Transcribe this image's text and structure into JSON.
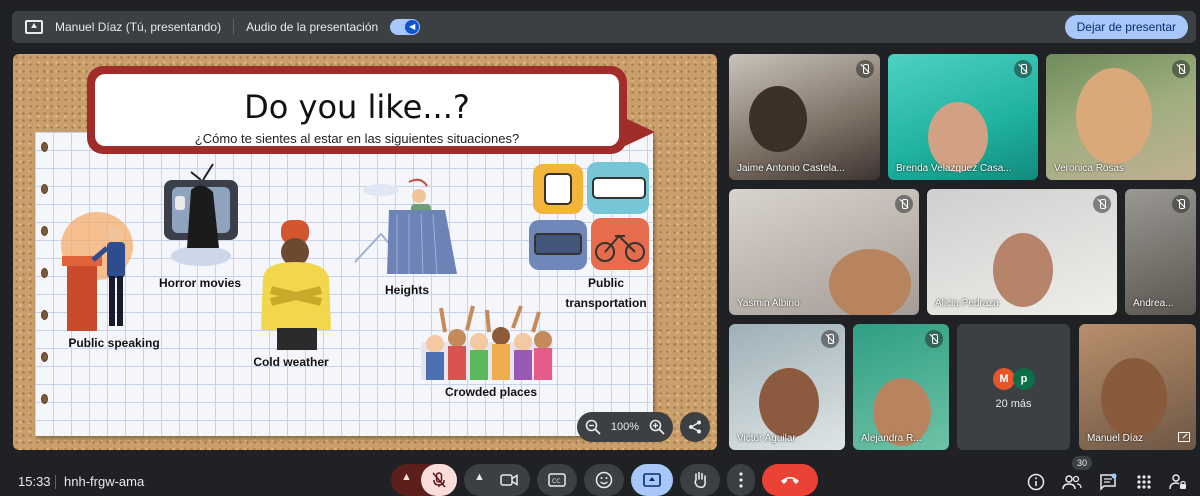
{
  "topbar": {
    "presenter": "Manuel Díaz (Tú, presentando)",
    "audio_label": "Audio de la presentación",
    "stop_button": "Dejar de presentar"
  },
  "slide": {
    "title": "Do you like...?",
    "subtitle": "¿Cómo te sientes al estar en las siguientes situaciones?",
    "labels": {
      "public_speaking": "Public speaking",
      "horror_movies": "Horror movies",
      "cold_weather": "Cold weather",
      "heights": "Heights",
      "public_transportation_1": "Public",
      "public_transportation_2": "transportation",
      "crowded_places": "Crowded places"
    },
    "zoom": "100%"
  },
  "participants": [
    {
      "name": "Jaime Antonio Castela..."
    },
    {
      "name": "Brenda Velazquez Casa..."
    },
    {
      "name": "Veronica Rosas"
    },
    {
      "name": "Yasmin Albino"
    },
    {
      "name": "Alicia Pedraza"
    },
    {
      "name": "Andrea..."
    },
    {
      "name": "Victor Aguilar"
    },
    {
      "name": "Alejandra R..."
    },
    {
      "name": "Manuel Díaz"
    }
  ],
  "more_tile": {
    "avatar_1": "M",
    "avatar_2": "p",
    "label": "20 más"
  },
  "bottombar": {
    "time": "15:33",
    "meeting_code": "hnh-frgw-ama",
    "participant_count": "30"
  },
  "colors": {
    "accent": "#a8c7fa",
    "end_call": "#ea4335",
    "present_active": "#a8c7fa",
    "mic_off": "#f9dedc"
  }
}
